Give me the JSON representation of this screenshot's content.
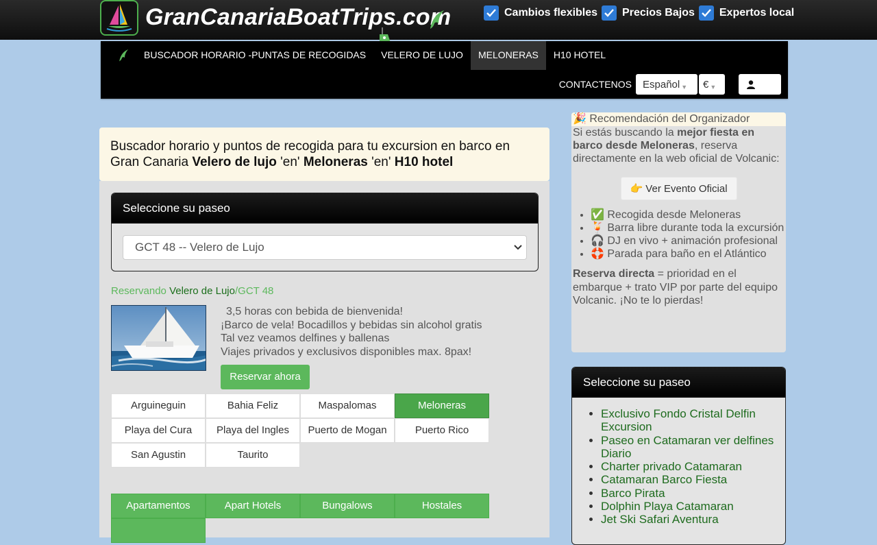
{
  "header": {
    "logo_text": "GranCanariaBoatTrips.com",
    "perks": [
      "Cambios flexibles",
      "Precios Bajos",
      "Expertos local"
    ]
  },
  "nav": {
    "items": [
      {
        "label": "BUSCADOR HORARIO -PUNTAS DE RECOGIDAS",
        "active": false
      },
      {
        "label": "VELERO DE LUJO",
        "active": false
      },
      {
        "label": "MELONERAS",
        "active": true
      },
      {
        "label": "H10 HOTEL",
        "active": false
      }
    ],
    "contact": "CONTACTENOS",
    "language": "Español",
    "currency": "€"
  },
  "headline": {
    "text": "Buscador horario y puntos de recogida para tu excursion en barco en Gran Canaria",
    "trip": "Velero de lujo",
    "en": "'en'",
    "location": "Meloneras",
    "hotel": "H10 hotel"
  },
  "select_card": {
    "title": "Seleccione su paseo",
    "selected": "GCT 48 -- Velero de Lujo"
  },
  "reservation": {
    "prefix": "Reservando",
    "trip": "Velero de Lujo",
    "code": "/GCT 48",
    "features": [
      "3,5 horas con bebida de bienvenida!",
      "¡Barco de vela! Bocadillos y bebidas sin alcohol gratis",
      "Tal vez veamos delfines y ballenas",
      "Viajes privados y exclusivos disponibles max. 8pax!"
    ],
    "book_label": "Reservar ahora"
  },
  "locations": [
    {
      "label": "Arguineguin",
      "active": false
    },
    {
      "label": "Bahia Feliz",
      "active": false
    },
    {
      "label": "Maspalomas",
      "active": false
    },
    {
      "label": "Meloneras",
      "active": true
    },
    {
      "label": "Playa del Cura",
      "active": false
    },
    {
      "label": "Playa del Ingles",
      "active": false
    },
    {
      "label": "Puerto de Mogan",
      "active": false
    },
    {
      "label": "Puerto Rico",
      "active": false
    },
    {
      "label": "San Agustin",
      "active": false
    },
    {
      "label": "Taurito",
      "active": false
    }
  ],
  "accommodation": [
    "Apartamentos",
    "Apart Hotels",
    "Bungalows",
    "Hostales",
    ""
  ],
  "recommendation": {
    "title": "🎉 Recomendación del Organizador",
    "intro_pre": "Si estás buscando la ",
    "intro_bold": "mejor fiesta en barco desde Meloneras",
    "intro_post": ", reserva directamente en la web oficial de Volcanic:",
    "cta": "👉 Ver Evento Oficial",
    "bullets": [
      "✅ Recogida desde Meloneras",
      "🍹 Barra libre durante toda la excursión",
      "🎧 DJ en vivo + animación profesional",
      "🛟 Parada para baño en el Atlántico"
    ],
    "footer_bold": "Reserva directa",
    "footer_text": " = prioridad en el embarque + trato VIP por parte del equipo Volcanic. ¡No te lo pierdas!"
  },
  "paseo_card": {
    "title": "Seleccione su paseo",
    "links": [
      "Exclusivo Fondo Cristal Delfin Excursion",
      "Paseo en Catamaran ver delfines Diario",
      "Charter privado Catamaran",
      "Catamaran Barco Fiesta",
      "Barco Pirata",
      "Dolphin Playa Catamaran",
      "Jet Ski Safari Aventura"
    ]
  }
}
